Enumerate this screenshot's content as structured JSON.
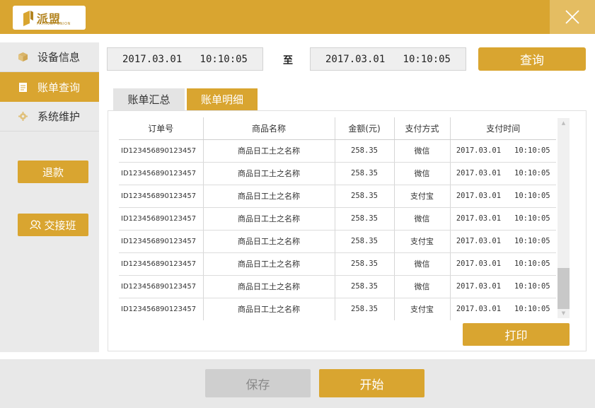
{
  "header": {
    "logo_cn": "派盟",
    "logo_en": "PAYMENT UNION",
    "close_icon": "close-icon",
    "brand_color": "#d9a530"
  },
  "sidebar": {
    "items": [
      {
        "label": "设备信息",
        "icon": "cube-icon",
        "active": false
      },
      {
        "label": "账单查询",
        "icon": "document-icon",
        "active": true
      },
      {
        "label": "系统维护",
        "icon": "gear-icon",
        "active": false
      }
    ],
    "refund_label": "退款",
    "handover_label": "交接班",
    "handover_icon": "people-icon"
  },
  "search": {
    "start_date": "2017.03.01   10:10:05",
    "to_label": "至",
    "end_date": "2017.03.01   10:10:05",
    "query_label": "查询"
  },
  "tabs": [
    {
      "label": "账单汇总",
      "active": false
    },
    {
      "label": "账单明细",
      "active": true
    }
  ],
  "table": {
    "headers": [
      "订单号",
      "商品名称",
      "金额(元)",
      "支付方式",
      "支付时间"
    ],
    "rows": [
      [
        "ID123456890123457",
        "商品日工土之名称",
        "258.35",
        "微信",
        "2017.03.01   10:10:05"
      ],
      [
        "ID123456890123457",
        "商品日工土之名称",
        "258.35",
        "微信",
        "2017.03.01   10:10:05"
      ],
      [
        "ID123456890123457",
        "商品日工土之名称",
        "258.35",
        "支付宝",
        "2017.03.01   10:10:05"
      ],
      [
        "ID123456890123457",
        "商品日工土之名称",
        "258.35",
        "微信",
        "2017.03.01   10:10:05"
      ],
      [
        "ID123456890123457",
        "商品日工土之名称",
        "258.35",
        "支付宝",
        "2017.03.01   10:10:05"
      ],
      [
        "ID123456890123457",
        "商品日工土之名称",
        "258.35",
        "微信",
        "2017.03.01   10:10:05"
      ],
      [
        "ID123456890123457",
        "商品日工土之名称",
        "258.35",
        "微信",
        "2017.03.01   10:10:05"
      ],
      [
        "ID123456890123457",
        "商品日工土之名称",
        "258.35",
        "支付宝",
        "2017.03.01   10:10:05"
      ]
    ]
  },
  "print_label": "打印",
  "footer": {
    "save_label": "保存",
    "start_label": "开始"
  }
}
